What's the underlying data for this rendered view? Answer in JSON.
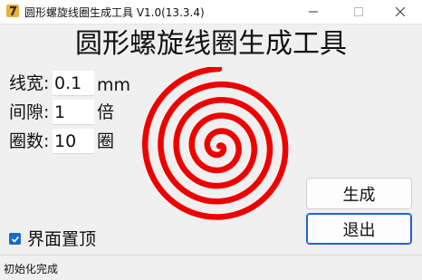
{
  "window": {
    "title": "圆形螺旋线圈生成工具 V1.0(13.3.4)",
    "icons": {
      "app": "app-icon",
      "minimize": "minimize-icon",
      "maximize": "maximize-icon",
      "close": "close-icon"
    }
  },
  "heading": "圆形螺旋线圈生成工具",
  "form": {
    "line_width": {
      "label": "线宽:",
      "value": "0.1",
      "unit": "mm"
    },
    "gap": {
      "label": "间隙:",
      "value": "1",
      "unit": "倍"
    },
    "turns": {
      "label": "圈数:",
      "value": "10",
      "unit": "圈"
    }
  },
  "preview": {
    "color": "#ee0000",
    "turns": 5
  },
  "buttons": {
    "generate": "生成",
    "quit": "退出"
  },
  "topmost": {
    "label": "界面置顶",
    "checked": true
  },
  "status": "初始化完成"
}
